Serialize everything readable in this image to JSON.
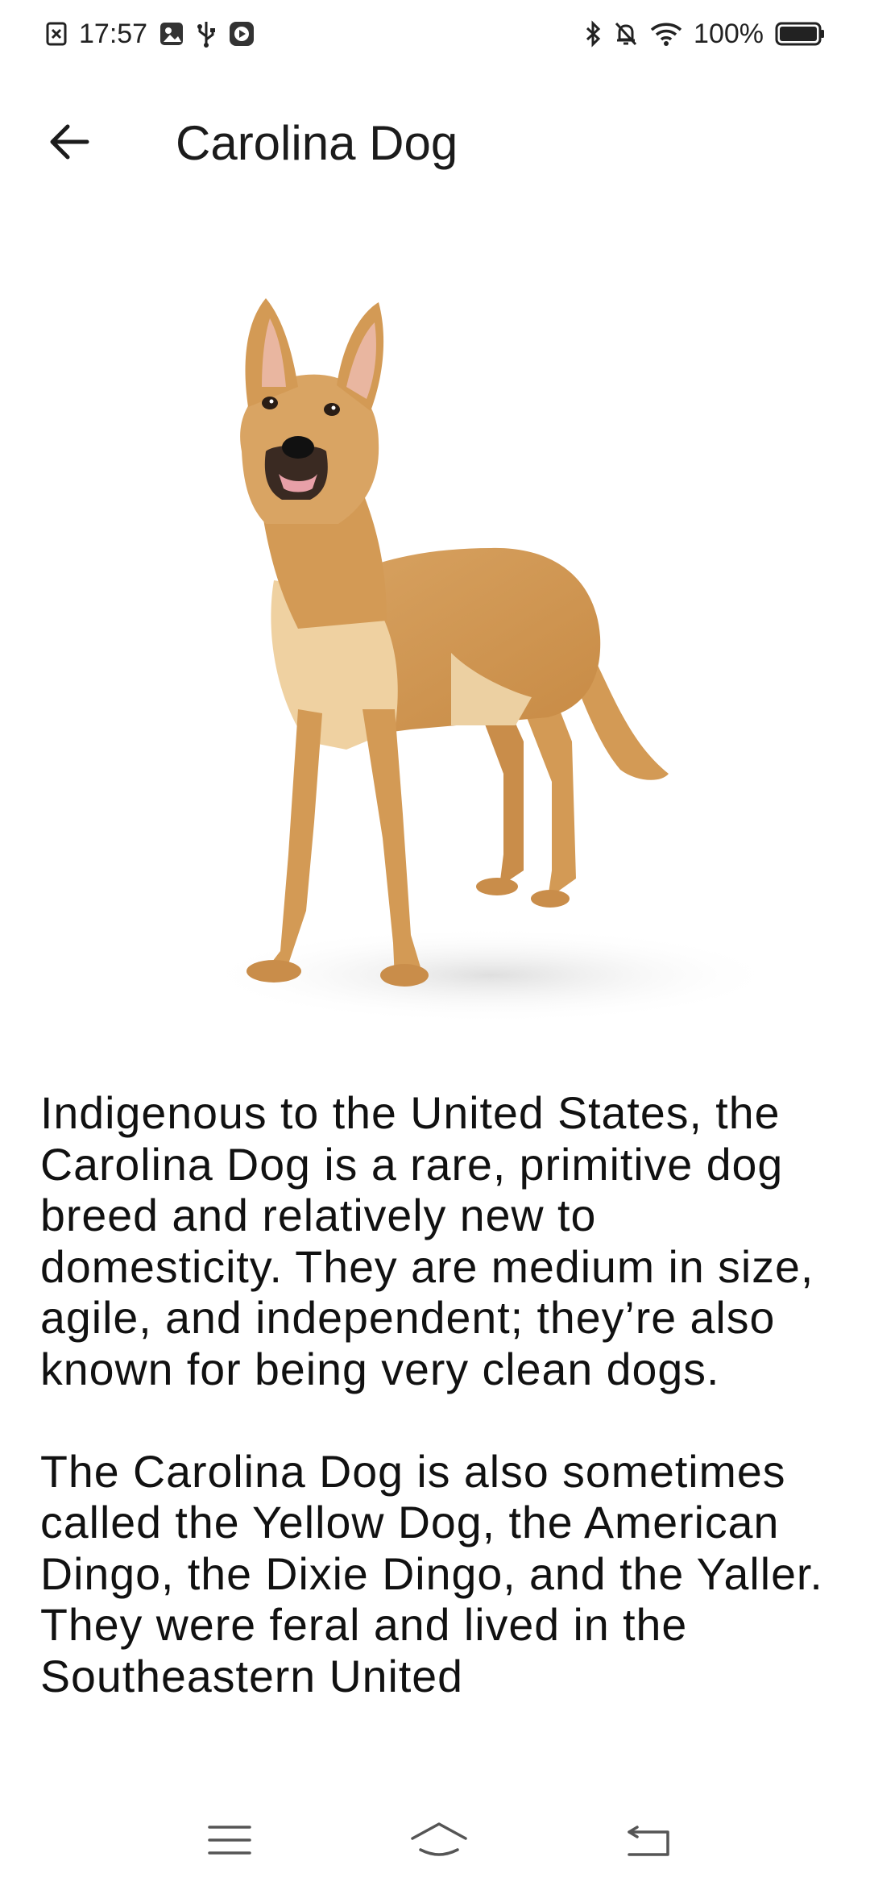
{
  "status_bar": {
    "time": "17:57",
    "battery_percent": "100%",
    "battery_level": 1.0,
    "left_icons": [
      "screenshot-notification-icon",
      "photo-app-icon",
      "usb-icon",
      "media-icon"
    ],
    "right_icons": [
      "bluetooth-icon",
      "silent-bell-icon",
      "wifi-icon",
      "battery-icon"
    ]
  },
  "app_bar": {
    "title": "Carolina Dog",
    "back_icon": "back-arrow-icon"
  },
  "hero_image": {
    "subject": "carolina-dog-photo"
  },
  "description": {
    "paragraphs": [
      "Indigenous to the United States, the Carolina Dog is a rare, primitive dog breed and relatively new to domesticity. They are medium in size, agile, and independent; they’re also known for being very clean dogs.",
      "The Carolina Dog is also sometimes called the Yellow Dog, the American Dingo, the Dixie Dingo, and the Yaller. They were feral and lived in the Southeastern United"
    ]
  },
  "nav_bar": {
    "items": [
      "menu-icon",
      "home-icon",
      "back-icon"
    ]
  },
  "colors": {
    "background": "#ffffff",
    "text": "#1b1b1b",
    "dog_coat": "#d39a55",
    "dog_light": "#f1d4a4",
    "dog_dark": "#b0783c"
  }
}
